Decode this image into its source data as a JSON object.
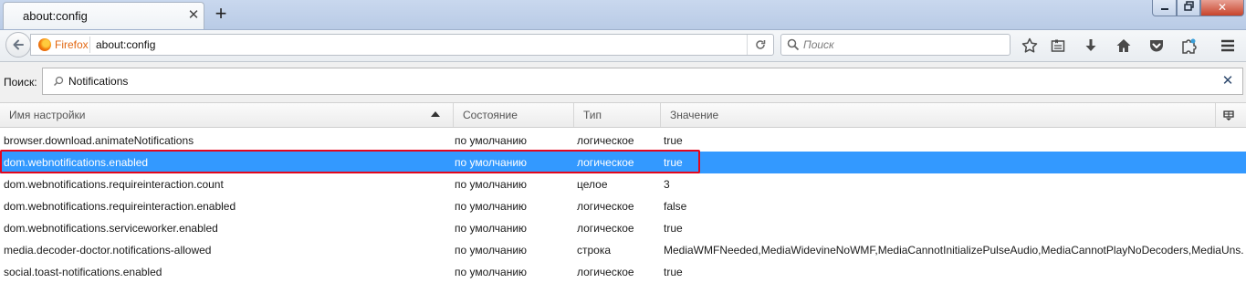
{
  "tab": {
    "title": "about:config"
  },
  "navbar": {
    "identity_label": "Firefox",
    "url": "about:config",
    "search_placeholder": "Поиск"
  },
  "filter": {
    "label": "Поиск:",
    "value": "Notifications"
  },
  "columns": {
    "name": "Имя настройки",
    "status": "Состояние",
    "type": "Тип",
    "value": "Значение"
  },
  "rows": [
    {
      "name": "browser.download.animateNotifications",
      "status": "по умолчанию",
      "type": "логическое",
      "value": "true"
    },
    {
      "name": "dom.webnotifications.enabled",
      "status": "по умолчанию",
      "type": "логическое",
      "value": "true",
      "selected": true
    },
    {
      "name": "dom.webnotifications.requireinteraction.count",
      "status": "по умолчанию",
      "type": "целое",
      "value": "3"
    },
    {
      "name": "dom.webnotifications.requireinteraction.enabled",
      "status": "по умолчанию",
      "type": "логическое",
      "value": "false"
    },
    {
      "name": "dom.webnotifications.serviceworker.enabled",
      "status": "по умолчанию",
      "type": "логическое",
      "value": "true"
    },
    {
      "name": "media.decoder-doctor.notifications-allowed",
      "status": "по умолчанию",
      "type": "строка",
      "value": "MediaWMFNeeded,MediaWidevineNoWMF,MediaCannotInitializePulseAudio,MediaCannotPlayNoDecoders,MediaUns..."
    },
    {
      "name": "social.toast-notifications.enabled",
      "status": "по умолчанию",
      "type": "логическое",
      "value": "true"
    }
  ],
  "colors": {
    "selection": "#3399ff",
    "highlight_border": "#e3061d",
    "identity": "#e26712"
  },
  "icons": {
    "tab_close": "close-icon",
    "new_tab": "plus-icon",
    "back": "back-arrow-icon",
    "reload": "reload-icon",
    "search": "search-icon",
    "bookmark": "star-icon",
    "reading_list": "bookmarks-list-icon",
    "downloads": "download-icon",
    "home": "home-icon",
    "pocket": "pocket-icon",
    "extension": "puzzle-icon",
    "menu": "hamburger-menu-icon",
    "column_picker": "column-picker-icon"
  }
}
